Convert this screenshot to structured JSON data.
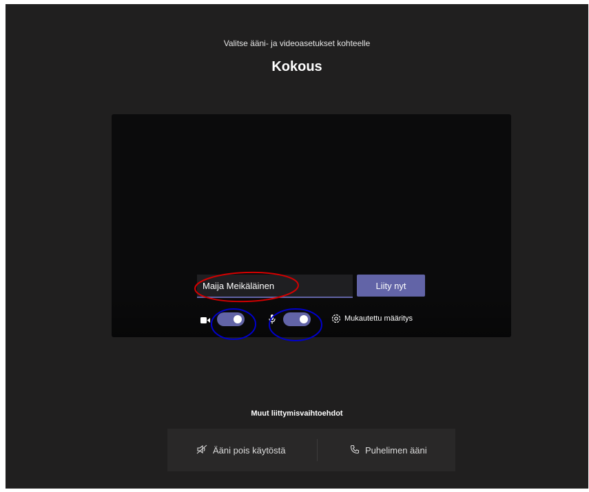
{
  "header": {
    "subtitle": "Valitse ääni- ja videoasetukset kohteelle",
    "title": "Kokous"
  },
  "prejoin": {
    "name_value": "Maija Meikäläinen",
    "join_label": "Liity nyt",
    "camera": {
      "icon": "video-camera-icon",
      "state": "on"
    },
    "microphone": {
      "icon": "microphone-icon",
      "state": "on"
    },
    "device_settings_icon": "gear-icon",
    "device_settings_label": "Mukautettu määritys"
  },
  "other_options": {
    "heading": "Muut liittymisvaihtoehdot",
    "audio_off_icon": "speaker-off-icon",
    "audio_off_label": "Ääni pois käytöstä",
    "phone_icon": "phone-icon",
    "phone_label": "Puhelimen ääni"
  },
  "colors": {
    "background": "#201f1f",
    "accent": "#6264a7",
    "annotation_red": "#d40000",
    "annotation_blue": "#0000cc"
  }
}
